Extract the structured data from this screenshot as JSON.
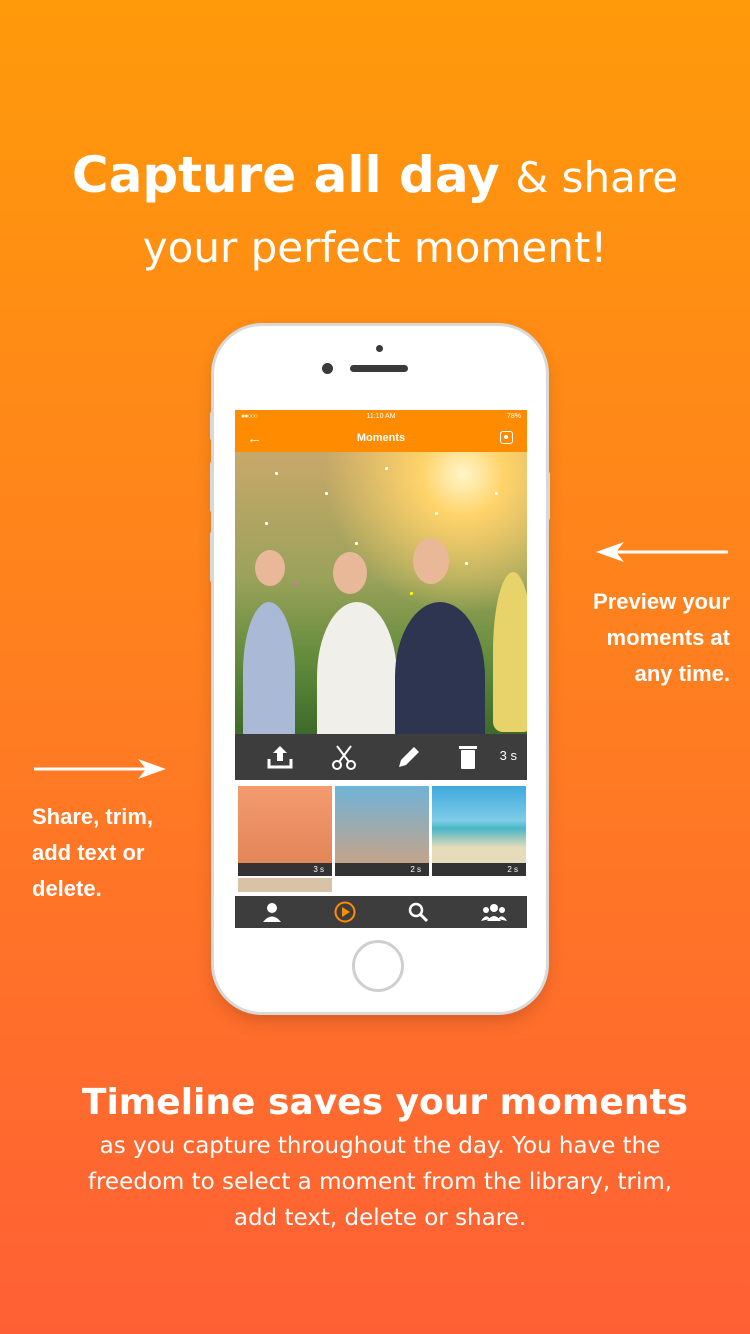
{
  "headline": {
    "bold": "Capture all day",
    "rest": "& share",
    "line2": "your perfect moment!"
  },
  "app": {
    "status": {
      "carrier_dots": "●●○○○",
      "time": "11:10 AM",
      "battery": "78%"
    },
    "nav": {
      "back_icon": "arrow-left-icon",
      "title": "Moments",
      "action_icon": "record-icon"
    },
    "toolbar": {
      "share_icon": "upload-icon",
      "trim_icon": "scissors-icon",
      "edit_icon": "pencil-icon",
      "delete_icon": "trash-icon",
      "duration": "3 s"
    },
    "thumbnails": [
      {
        "duration": "3 s",
        "subject": "wedding-confetti"
      },
      {
        "duration": "2 s",
        "subject": "friends-selfie"
      },
      {
        "duration": "2 s",
        "subject": "beach-island"
      }
    ],
    "tabbar": [
      "profile-icon",
      "play-icon",
      "search-icon",
      "group-icon"
    ]
  },
  "annotations": {
    "right": [
      "Preview your",
      "moments at",
      "any time."
    ],
    "left": [
      "Share, trim,",
      "add text or",
      "delete."
    ]
  },
  "footer": {
    "title": "Timeline saves your moments",
    "lines": [
      "as you capture throughout the day.  You have the",
      "freedom to select a moment from the library, trim,",
      "add text, delete or share."
    ]
  },
  "colors": {
    "brand_orange": "#ff8c00",
    "toolbar_dark": "#3d3d3d"
  }
}
